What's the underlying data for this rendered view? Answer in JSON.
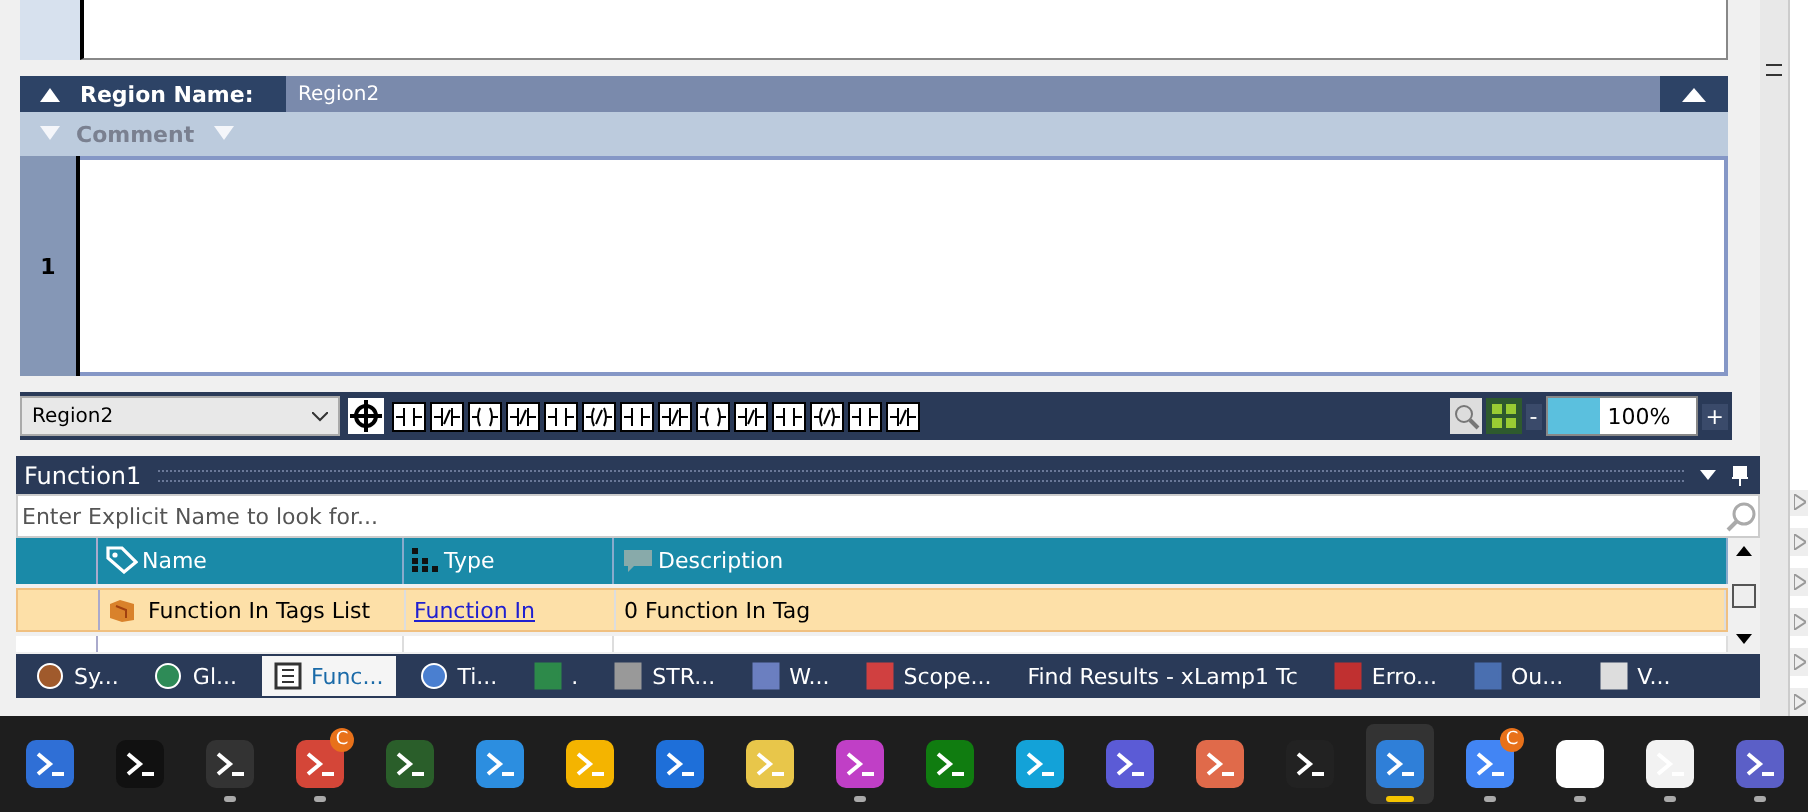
{
  "editor": {
    "region_label": "Region Name:",
    "region_value": "Region2",
    "comment_label": "Comment",
    "rung_number": "1"
  },
  "toolbar": {
    "region_select": "Region2",
    "zoom": "100%",
    "zoom_minus": "-",
    "zoom_plus": "+"
  },
  "panel": {
    "title": "Function1",
    "search": {
      "placeholder": "Enter Explicit Name to look for..."
    },
    "columns": [
      {
        "label": "Name",
        "kind": "tag"
      },
      {
        "label": "Type",
        "kind": "type"
      },
      {
        "label": "Description",
        "kind": "comment"
      }
    ],
    "rows": [
      {
        "name": "Function In Tags List",
        "type": "Function In",
        "description": "0 Function In Tag",
        "selected": true
      }
    ]
  },
  "bottom_tabs": [
    {
      "label": "Sy...",
      "kind": "gear",
      "selected": false
    },
    {
      "label": "Gl...",
      "kind": "globe",
      "selected": false
    },
    {
      "label": "Func...",
      "kind": "list",
      "selected": true
    },
    {
      "label": "Ti...",
      "kind": "clock",
      "selected": false
    },
    {
      "label": ".",
      "kind": "chart",
      "selected": false
    },
    {
      "label": "STR...",
      "kind": "database",
      "selected": false
    },
    {
      "label": "W...",
      "kind": "network",
      "selected": false
    },
    {
      "label": "Scope...",
      "kind": "scope",
      "selected": false
    },
    {
      "label": "Find Results - xLamp1 Tc",
      "kind": "none",
      "selected": false
    },
    {
      "label": "Erro...",
      "kind": "error",
      "selected": false
    },
    {
      "label": "Ou...",
      "kind": "output",
      "selected": false
    },
    {
      "label": "V...",
      "kind": "doc",
      "selected": false
    }
  ],
  "taskbar": [
    {
      "kind": "powershell",
      "running": false,
      "active": false
    },
    {
      "kind": "console",
      "running": false,
      "active": false
    },
    {
      "kind": "terminal",
      "running": true,
      "active": false
    },
    {
      "kind": "mail",
      "running": true,
      "active": false,
      "badge": "C"
    },
    {
      "kind": "tool",
      "running": false,
      "active": false
    },
    {
      "kind": "code",
      "running": false,
      "active": false
    },
    {
      "kind": "drive",
      "running": false,
      "active": false
    },
    {
      "kind": "fin",
      "running": false,
      "active": false
    },
    {
      "kind": "yellowapp",
      "running": false,
      "active": false
    },
    {
      "kind": "purpleapp",
      "running": true,
      "active": false
    },
    {
      "kind": "xbox",
      "running": false,
      "active": false
    },
    {
      "kind": "cyanapp",
      "running": false,
      "active": false
    },
    {
      "kind": "lines",
      "running": false,
      "active": false
    },
    {
      "kind": "spark",
      "running": false,
      "active": false
    },
    {
      "kind": "knot",
      "running": false,
      "active": false
    },
    {
      "kind": "shield",
      "running": true,
      "active": true
    },
    {
      "kind": "browser",
      "running": true,
      "active": false,
      "badge": "C"
    },
    {
      "kind": "triangle",
      "running": true,
      "active": false
    },
    {
      "kind": "pinwheel",
      "running": true,
      "active": false
    },
    {
      "kind": "teams",
      "running": true,
      "active": false
    }
  ]
}
